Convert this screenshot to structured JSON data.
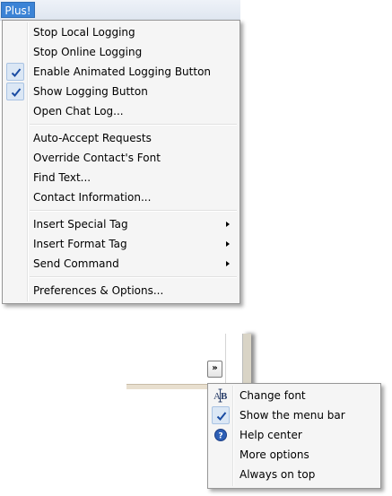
{
  "plus_menu": {
    "button_label": "Plus!",
    "groups": [
      [
        {
          "label": "Stop Local Logging",
          "checked": false
        },
        {
          "label": "Stop Online Logging",
          "checked": false
        },
        {
          "label": "Enable Animated Logging Button",
          "checked": true
        },
        {
          "label": "Show Logging Button",
          "checked": true
        },
        {
          "label": "Open Chat Log...",
          "checked": false
        }
      ],
      [
        {
          "label": "Auto-Accept Requests"
        },
        {
          "label": "Override Contact's Font"
        },
        {
          "label": "Find Text..."
        },
        {
          "label": "Contact Information..."
        }
      ],
      [
        {
          "label": "Insert Special Tag",
          "submenu": true
        },
        {
          "label": "Insert Format Tag",
          "submenu": true
        },
        {
          "label": "Send Command",
          "submenu": true
        }
      ],
      [
        {
          "label": "Preferences & Options..."
        }
      ]
    ]
  },
  "overflow_menu": {
    "chevron_label": "»",
    "items": [
      {
        "label": "Change font",
        "icon": "font-icon"
      },
      {
        "label": "Show the menu bar",
        "icon": "check-icon",
        "checked": true
      },
      {
        "label": "Help center",
        "icon": "help-icon"
      },
      {
        "label": "More options"
      },
      {
        "label": "Always on top"
      }
    ]
  },
  "colors": {
    "menu_background": "#f5f5f5",
    "menu_border": "#979797",
    "check_highlight": "#dbe7f5",
    "accent": "#3b83d6"
  }
}
